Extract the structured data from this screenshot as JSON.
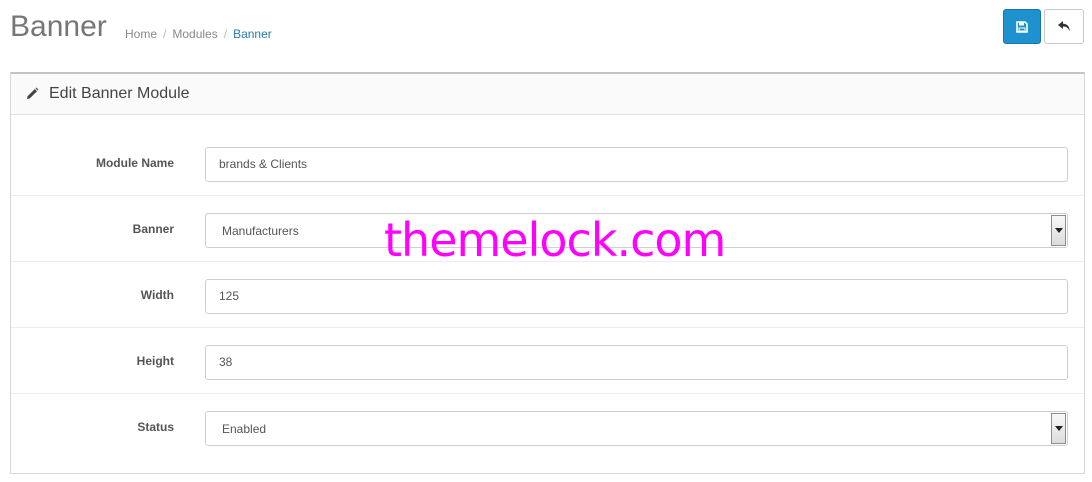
{
  "header": {
    "title": "Banner",
    "breadcrumb": [
      {
        "label": "Home",
        "active": false
      },
      {
        "label": "Modules",
        "active": false
      },
      {
        "label": "Banner",
        "active": true
      }
    ],
    "save_icon": "floppy-disk-icon",
    "back_icon": "reply-arrow-icon",
    "primary_color": "#1e91cf"
  },
  "panel": {
    "heading_icon": "pencil-icon",
    "heading": "Edit Banner Module",
    "fields": {
      "module_name": {
        "label": "Module Name",
        "value": "brands & Clients"
      },
      "banner": {
        "label": "Banner",
        "value": "Manufacturers"
      },
      "width": {
        "label": "Width",
        "value": "125"
      },
      "height": {
        "label": "Height",
        "value": "38"
      },
      "status": {
        "label": "Status",
        "value": "Enabled"
      }
    }
  },
  "watermark": {
    "text": "themelock.com",
    "color": "#ff00ff"
  }
}
